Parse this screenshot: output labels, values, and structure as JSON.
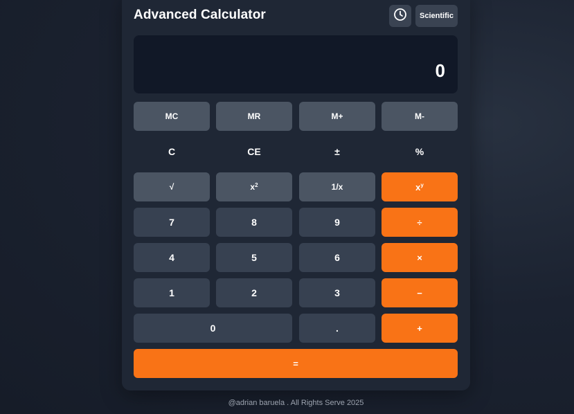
{
  "header": {
    "title": "Advanced Calculator",
    "history_icon": "clock-icon",
    "mode_label": "Scientific"
  },
  "display": {
    "value": "0"
  },
  "memory_row": [
    "MC",
    "MR",
    "M+",
    "M-"
  ],
  "function_row": [
    "C",
    "CE",
    "±",
    "%"
  ],
  "scientific_row": {
    "sqrt": "√",
    "square_base": "x",
    "square_exp": "2",
    "reciprocal": "1/x",
    "power_base": "x",
    "power_exp": "y"
  },
  "digits": {
    "d7": "7",
    "d8": "8",
    "d9": "9",
    "d4": "4",
    "d5": "5",
    "d6": "6",
    "d1": "1",
    "d2": "2",
    "d3": "3",
    "d0": "0",
    "dot": "."
  },
  "operators": {
    "divide": "÷",
    "multiply": "×",
    "subtract": "−",
    "add": "+",
    "equals": "="
  },
  "colors": {
    "accent": "#f97316",
    "display_bg": "#111827",
    "card_bg": "#1f2735"
  },
  "footer": {
    "text": "@adrian baruela . All Rights Serve 2025"
  }
}
